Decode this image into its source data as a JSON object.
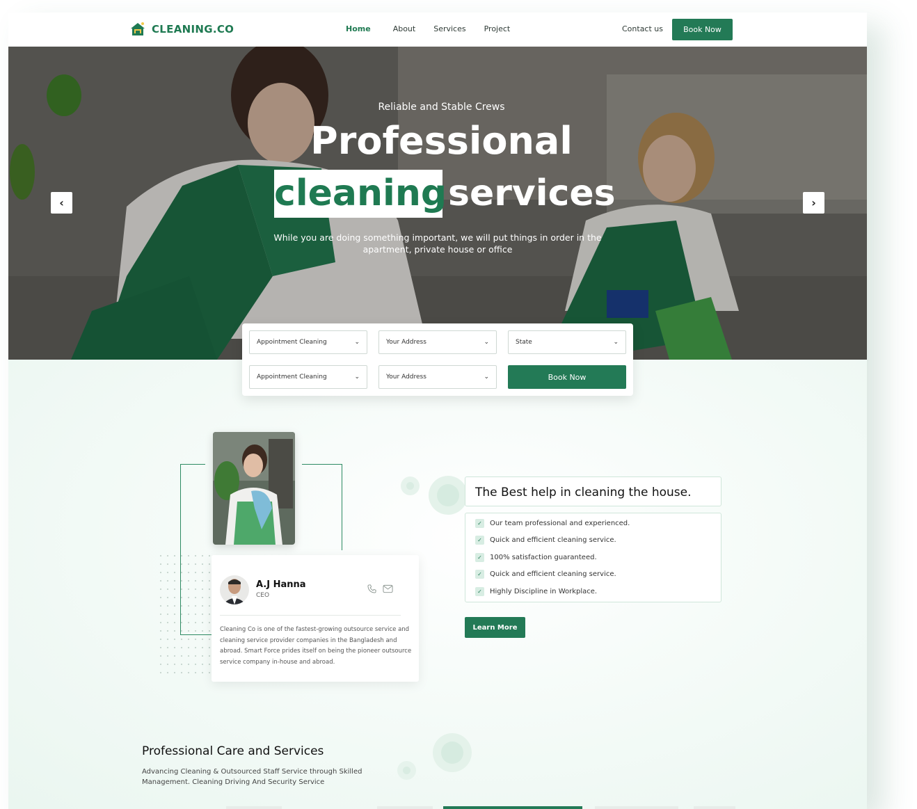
{
  "brand": {
    "name": "CLEANING.CO",
    "color": "#1f7a52"
  },
  "nav": {
    "items": [
      "Home",
      "About",
      "Services",
      "Project"
    ],
    "active": "Home",
    "contact": "Contact us",
    "book_now": "Book Now"
  },
  "hero": {
    "eyebrow": "Reliable and Stable Crews",
    "title_line1": "Professional",
    "title_highlight": "cleaning",
    "title_rest": "services",
    "subtitle": "While you are doing something important, we will put things in order in the apartment, private house or office"
  },
  "booking_form": {
    "row1": [
      "Appointment Cleaning",
      "Your Address",
      "State"
    ],
    "row2": [
      "Appointment Cleaning",
      "Your Address"
    ],
    "submit": "Book Now"
  },
  "about": {
    "ceo_name": "A.J Hanna",
    "ceo_role": "CEO",
    "description": "Cleaning Co is one of the fastest-growing outsource service and cleaning service provider companies in the Bangladesh and abroad. Smart Force prides itself on being the pioneer outsource service company in-house and abroad.",
    "heading": "The Best help in cleaning the house.",
    "features": [
      "Our team professional and experienced.",
      "Quick and efficient cleaning service.",
      "100% satisfaction guaranteed.",
      "Quick and efficient cleaning service.",
      "Highly Discipline in Workplace."
    ],
    "cta": "Learn More"
  },
  "care": {
    "title": "Professional Care and Services",
    "description": "Advancing Cleaning & Outsourced Staff Service through Skilled Management. Cleaning Driving And Security Service"
  },
  "icons": [
    "logo-house-icon",
    "chevron-left-icon",
    "chevron-right-icon",
    "chevron-down-icon",
    "phone-icon",
    "mail-icon",
    "check-icon"
  ],
  "colors": {
    "primary": "#237a56",
    "background": "#f3faf7"
  }
}
